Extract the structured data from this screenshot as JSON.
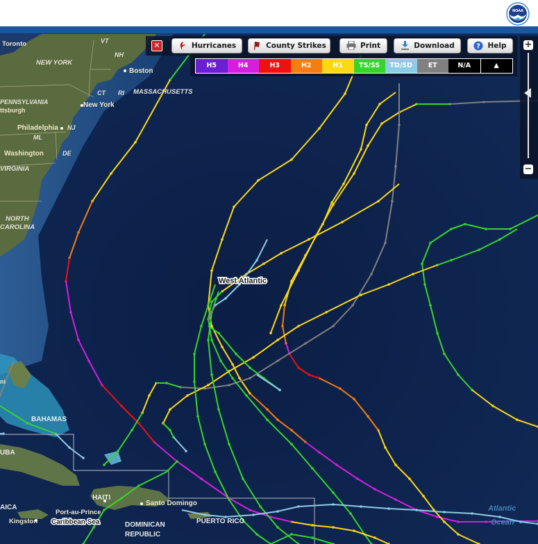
{
  "header": {
    "logo": "noaa-logo",
    "logo_text": "NOAA"
  },
  "toolbar": {
    "close_label": "✕",
    "buttons": [
      {
        "id": "hurricanes",
        "label": "Hurricanes",
        "icon": "hurricane-icon"
      },
      {
        "id": "county-strikes",
        "label": "County Strikes",
        "icon": "flag-icon"
      },
      {
        "id": "print",
        "label": "Print",
        "icon": "printer-icon"
      },
      {
        "id": "download",
        "label": "Download",
        "icon": "download-icon"
      },
      {
        "id": "help",
        "label": "Help",
        "icon": "help-icon"
      }
    ]
  },
  "legend": {
    "categories": [
      {
        "label": "H5",
        "color": "#6a1fd0",
        "text": "#ffffff"
      },
      {
        "label": "H4",
        "color": "#d41fe0",
        "text": "#ffffff"
      },
      {
        "label": "H3",
        "color": "#ee1111",
        "text": "#ffffff"
      },
      {
        "label": "H2",
        "color": "#f57d12",
        "text": "#ffffff"
      },
      {
        "label": "H1",
        "color": "#ffd814",
        "text": "#ffffff"
      },
      {
        "label": "TS/SS",
        "color": "#37d52c",
        "text": "#ffffff"
      },
      {
        "label": "TD/SD",
        "color": "#8fcbe6",
        "text": "#ffffff"
      },
      {
        "label": "ET",
        "color": "#808080",
        "text": "#ffffff"
      },
      {
        "label": "N/A",
        "color": "#000000",
        "text": "#ffffff"
      }
    ],
    "toggle_label": "▲"
  },
  "zoom": {
    "plus_label": "+",
    "minus_label": "−",
    "level_fraction": 0.72
  },
  "map": {
    "labels": [
      {
        "text": "Toronto",
        "kind": "city"
      },
      {
        "text": "VT",
        "kind": "state"
      },
      {
        "text": "NH",
        "kind": "state"
      },
      {
        "text": "NEW YORK",
        "kind": "state"
      },
      {
        "text": "Boston",
        "kind": "city"
      },
      {
        "text": "CT",
        "kind": "state"
      },
      {
        "text": "RI",
        "kind": "state"
      },
      {
        "text": "MASSACHUSETTS",
        "kind": "state"
      },
      {
        "text": "PENNSYLVANIA",
        "kind": "state"
      },
      {
        "text": "New York",
        "kind": "city"
      },
      {
        "text": "ttsburgh",
        "kind": "city"
      },
      {
        "text": "Philadelphia",
        "kind": "city"
      },
      {
        "text": "NJ",
        "kind": "state"
      },
      {
        "text": "ML",
        "kind": "state"
      },
      {
        "text": "Washington",
        "kind": "city"
      },
      {
        "text": "DE",
        "kind": "state"
      },
      {
        "text": "VIRGINIA",
        "kind": "state"
      },
      {
        "text": "NORTH",
        "kind": "state"
      },
      {
        "text": "CAROLINA",
        "kind": "state"
      },
      {
        "text": "West Atlantic",
        "kind": "selected"
      },
      {
        "text": "ni",
        "kind": "city"
      },
      {
        "text": "BAHAMAS",
        "kind": "country"
      },
      {
        "text": "UBA",
        "kind": "country"
      },
      {
        "text": "HAITI",
        "kind": "country"
      },
      {
        "text": "Port-au-Prince",
        "kind": "city"
      },
      {
        "text": "Santo Domingo",
        "kind": "city"
      },
      {
        "text": "AICA",
        "kind": "country"
      },
      {
        "text": "Kingston",
        "kind": "city"
      },
      {
        "text": "Caribbean Sea",
        "kind": "water"
      },
      {
        "text": "DOMINICAN",
        "kind": "country"
      },
      {
        "text": "REPUBLIC",
        "kind": "country"
      },
      {
        "text": "PUERTO RICO",
        "kind": "country"
      },
      {
        "text": "Atlantic",
        "kind": "ocean"
      },
      {
        "text": "Ocean",
        "kind": "ocean"
      }
    ]
  }
}
